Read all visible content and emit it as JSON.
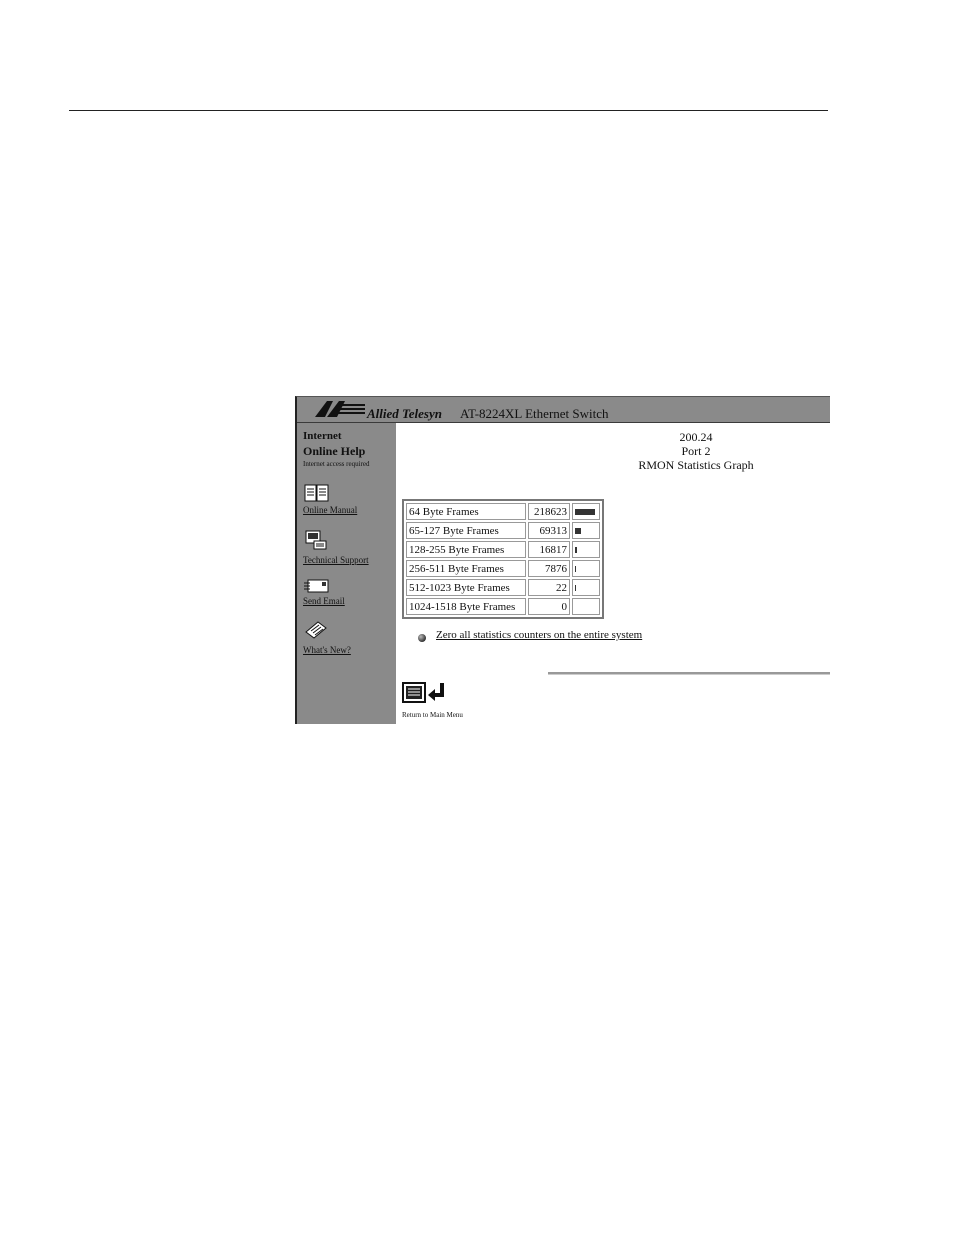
{
  "banner": {
    "brand": "Allied Telesyn",
    "product": "AT-8224XL Ethernet Switch"
  },
  "sidebar": {
    "title_line1": "Internet",
    "title_line2": "Online Help",
    "note": "Internet access required",
    "links": [
      {
        "label": "Online Manual",
        "icon": "book-icon"
      },
      {
        "label": "Technical Support",
        "icon": "phone-icon"
      },
      {
        "label": "Send Email",
        "icon": "envelope-icon"
      },
      {
        "label": "What's New?",
        "icon": "newspaper-icon"
      }
    ]
  },
  "header": {
    "ip": "200.24",
    "port": "Port 2",
    "title": "RMON Statistics Graph"
  },
  "stats": {
    "rows": [
      {
        "label": "64 Byte Frames",
        "value": "218623",
        "bar_fraction": 1.0
      },
      {
        "label": "65-127 Byte Frames",
        "value": "69313",
        "bar_fraction": 0.32
      },
      {
        "label": "128-255 Byte Frames",
        "value": "16817",
        "bar_fraction": 0.08
      },
      {
        "label": "256-511 Byte Frames",
        "value": "7876",
        "bar_fraction": 0.04
      },
      {
        "label": "512-1023 Byte Frames",
        "value": "22",
        "bar_fraction": 0.01
      },
      {
        "label": "1024-1518 Byte Frames",
        "value": "0",
        "bar_fraction": 0.0
      }
    ]
  },
  "actions": {
    "zero_link": "Zero all statistics counters on the entire system",
    "return_label": "Return to Main Menu"
  },
  "colors": {
    "banner": "#8a8a8a",
    "sidebar": "#8a8a8a",
    "bar": "#333333"
  }
}
